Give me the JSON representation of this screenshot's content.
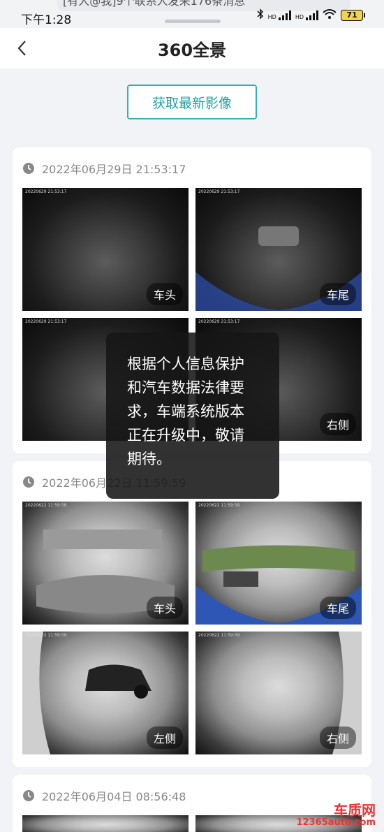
{
  "status_bar": {
    "time": "下午1:28",
    "notification": "[有人@我]9个联系人发来176条消息",
    "battery": "71",
    "network1": "HD",
    "network2": "HD"
  },
  "header": {
    "title": "360全景"
  },
  "fetch_button": {
    "label": "获取最新影像"
  },
  "records": [
    {
      "timestamp": "2022年06月29日 21:53:17",
      "images": [
        {
          "label": "车头"
        },
        {
          "label": "车尾"
        },
        {
          "label": ""
        },
        {
          "label": "右侧"
        }
      ]
    },
    {
      "timestamp": "2022年06月22日 11:59:59",
      "images": [
        {
          "label": "车头"
        },
        {
          "label": "车尾"
        },
        {
          "label": "左侧"
        },
        {
          "label": "右侧"
        }
      ]
    },
    {
      "timestamp": "2022年06月04日 08:56:48",
      "images": []
    }
  ],
  "toast": {
    "message": "根据个人信息保护和汽车数据法律要求，车端系统版本正在升级中，敬请期待。"
  },
  "watermark": {
    "brand": "车质网",
    "url": "12365auto.com"
  },
  "colors": {
    "accent": "#2fb2b2",
    "background": "#f1f3f6"
  }
}
